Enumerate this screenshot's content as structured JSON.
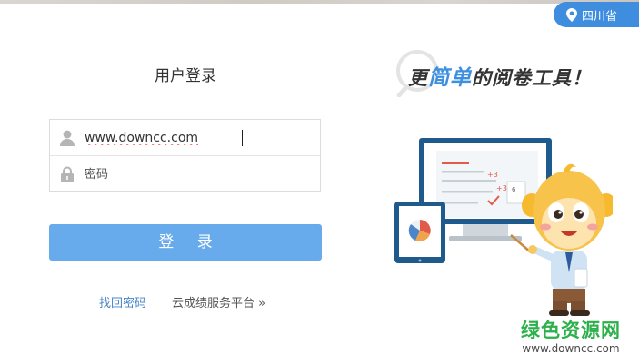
{
  "region": {
    "label": "四川省",
    "icon": "location-pin-icon"
  },
  "login": {
    "title": "用户登录",
    "username": {
      "value": "www.downcc.com",
      "icon": "user-icon"
    },
    "password": {
      "placeholder": "密码",
      "icon": "lock-icon"
    },
    "submit_label": "登 录"
  },
  "links": {
    "forgot": "找回密码",
    "cloud": "云成绩服务平台 »"
  },
  "promo": {
    "slogan_part1": "更",
    "slogan_highlight": "简单",
    "slogan_part2": "的阅卷工具！",
    "illustration": "exam-grading-mascot-illustration"
  },
  "watermark": {
    "title": "绿色资源网",
    "url": "www.downcc.com"
  },
  "colors": {
    "accent": "#3e8ddf",
    "button": "#68abec",
    "link": "#4a86c8",
    "watermark": "#2bb04a"
  }
}
